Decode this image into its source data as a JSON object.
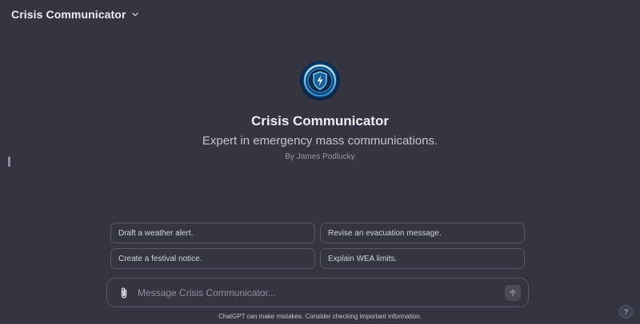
{
  "header": {
    "title": "Crisis Communicator",
    "dropdown_icon": "chevron-down-icon"
  },
  "gpt": {
    "name": "Crisis Communicator",
    "description": "Expert in emergency mass communications.",
    "author": "By James Podlucky",
    "avatar_icon": "shield-icon"
  },
  "suggestions": [
    {
      "label": "Draft a weather alert."
    },
    {
      "label": "Revise an evacuation message."
    },
    {
      "label": "Create a festival notice."
    },
    {
      "label": "Explain WEA limits."
    }
  ],
  "composer": {
    "placeholder": "Message Crisis Communicator...",
    "value": "",
    "attach_icon": "paperclip-icon",
    "send_icon": "arrow-up-icon"
  },
  "footer": {
    "disclaimer": "ChatGPT can make mistakes. Consider checking important information."
  },
  "help": {
    "label": "?"
  },
  "colors": {
    "background": "#343541",
    "border": "#565869",
    "text": "#ececf1",
    "muted": "#8e8ea0",
    "avatar_accent": "#5ec8ff"
  }
}
